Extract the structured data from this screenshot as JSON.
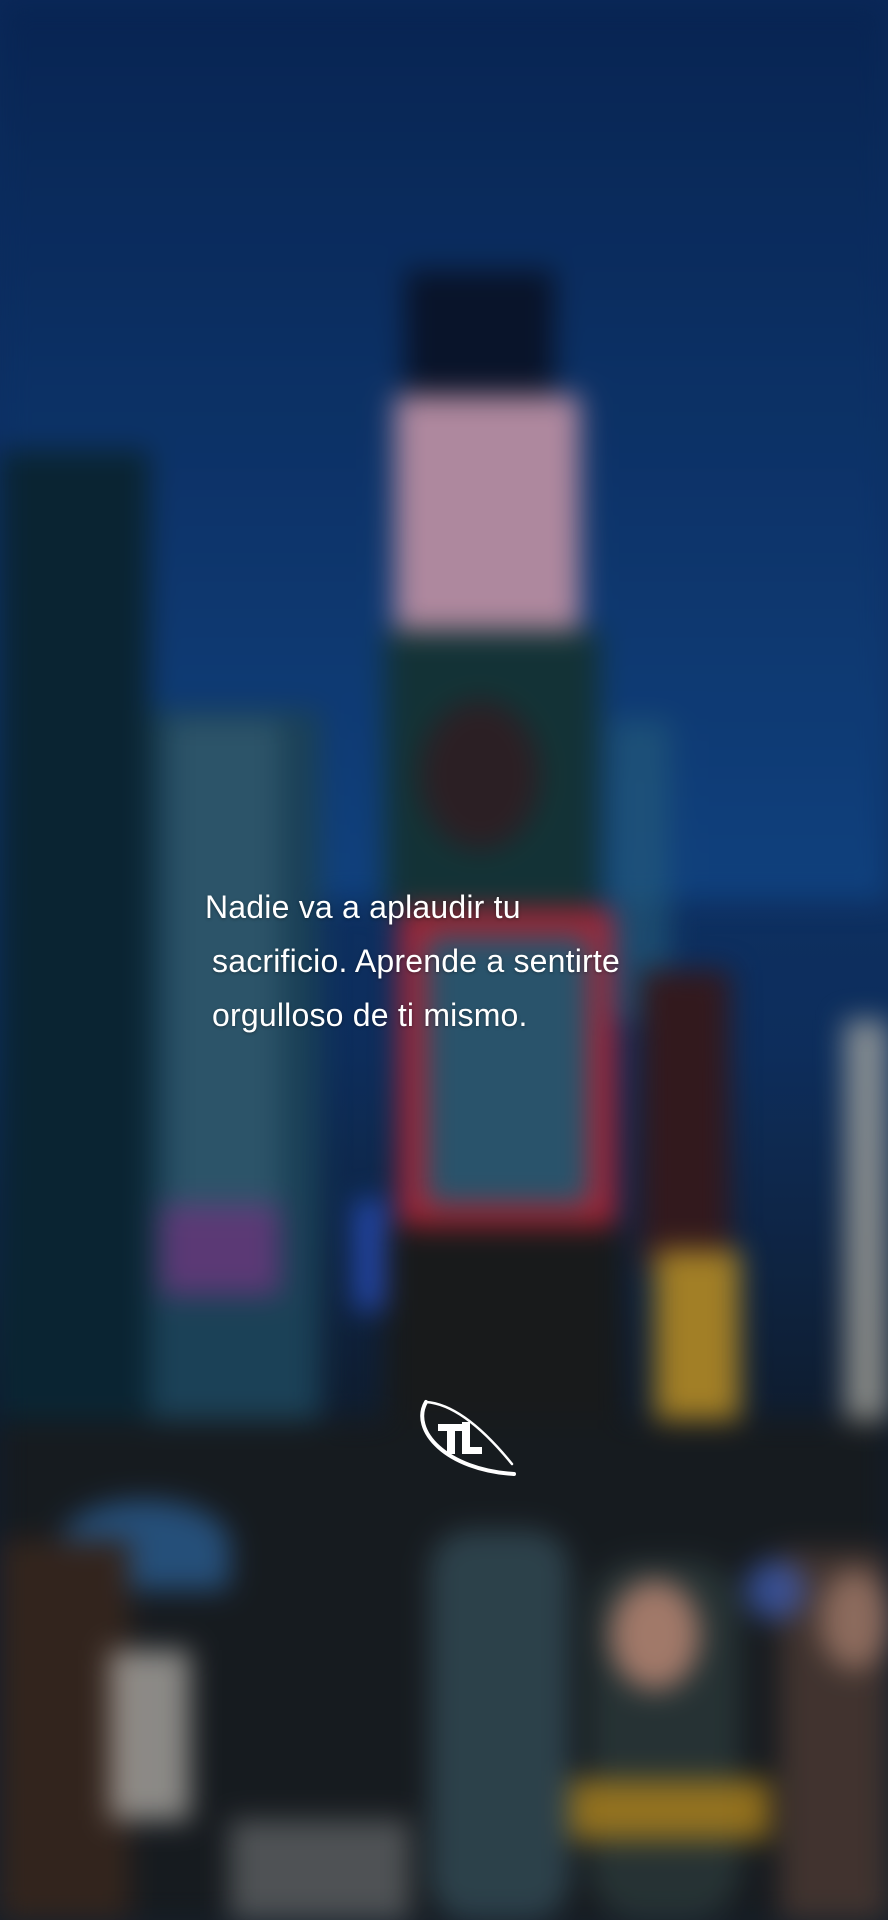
{
  "quote": {
    "lines": [
      "Nadie va a aplaudir tu",
      "sacrificio. Aprende a sentirte",
      "orgulloso de ti mismo."
    ]
  },
  "logo": {
    "icon": "tl-swoosh-logo-icon",
    "text": "TL"
  },
  "colors": {
    "sky": "#0d2f66",
    "text": "#ffffff"
  }
}
